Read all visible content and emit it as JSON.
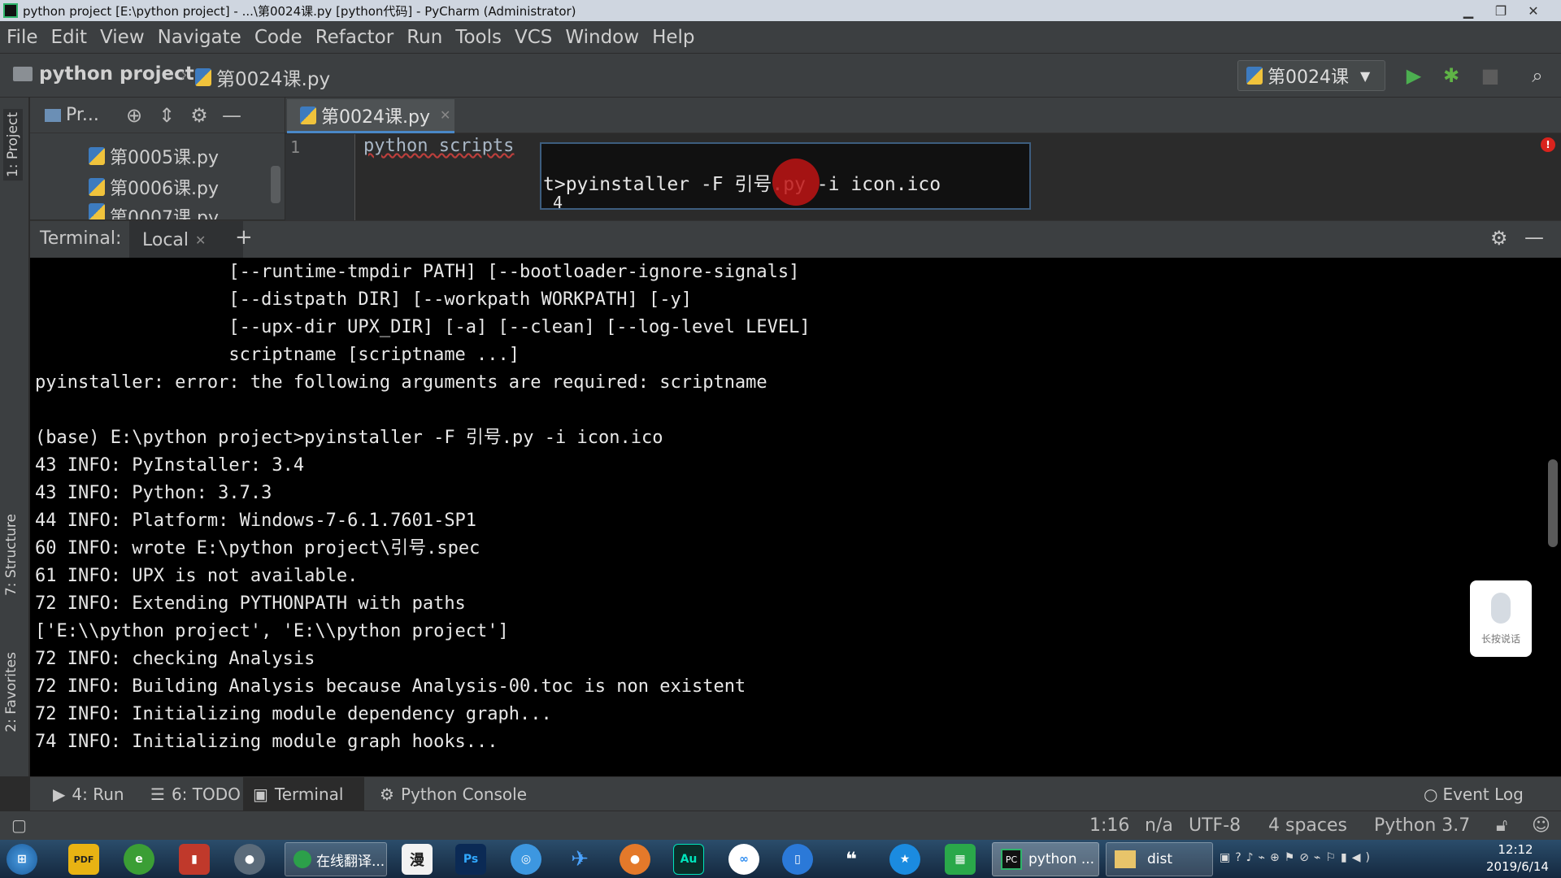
{
  "window": {
    "title": "python project [E:\\python project] - ...\\第0024课.py [python代码] - PyCharm (Administrator)"
  },
  "menu": [
    "File",
    "Edit",
    "View",
    "Navigate",
    "Code",
    "Refactor",
    "Run",
    "Tools",
    "VCS",
    "Window",
    "Help"
  ],
  "navbar": {
    "project": "python project",
    "file": "第0024课.py",
    "run_config": "第0024课"
  },
  "tool_windows": {
    "project": "1: Project",
    "structure": "7: Structure",
    "favorites": "2: Favorites"
  },
  "project_panel": {
    "dropdown": "Pr...",
    "files": [
      "第0005课.py",
      "第0006课.py",
      "第0007课.py"
    ]
  },
  "editor": {
    "tab": "第0024课.py",
    "line_number": "1",
    "code": "python scripts",
    "popup_text": "t>pyinstaller -F 引号.py -i icon.ico",
    "popup_line2": "4"
  },
  "terminal": {
    "label": "Terminal:",
    "tab": "Local",
    "lines": [
      "                  [--runtime-tmpdir PATH] [--bootloader-ignore-signals]",
      "                  [--distpath DIR] [--workpath WORKPATH] [-y]",
      "                  [--upx-dir UPX_DIR] [-a] [--clean] [--log-level LEVEL]",
      "                  scriptname [scriptname ...]",
      "pyinstaller: error: the following arguments are required: scriptname",
      "",
      "(base) E:\\python project>pyinstaller -F 引号.py -i icon.ico",
      "43 INFO: PyInstaller: 3.4",
      "43 INFO: Python: 3.7.3",
      "44 INFO: Platform: Windows-7-6.1.7601-SP1",
      "60 INFO: wrote E:\\python project\\引号.spec",
      "61 INFO: UPX is not available.",
      "72 INFO: Extending PYTHONPATH with paths",
      "['E:\\\\python project', 'E:\\\\python project']",
      "72 INFO: checking Analysis",
      "72 INFO: Building Analysis because Analysis-00.toc is non existent",
      "72 INFO: Initializing module dependency graph...",
      "74 INFO: Initializing module graph hooks..."
    ],
    "voice_label": "长按说话"
  },
  "bottom_tools": {
    "run": "4: Run",
    "todo": "6: TODO",
    "terminal": "Terminal",
    "console": "Python Console",
    "event_log": "Event Log"
  },
  "status": {
    "position": "1:16",
    "na": "n/a",
    "encoding": "UTF-8",
    "indent": "4 spaces",
    "interpreter": "Python 3.7"
  },
  "taskbar": {
    "translate": "在线翻译...",
    "pycharm": "python ...",
    "dist": "dist",
    "time": "12:12",
    "date": "2019/6/14"
  }
}
